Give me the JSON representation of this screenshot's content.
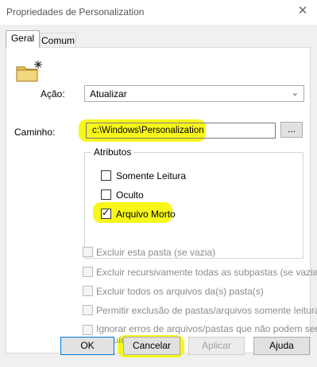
{
  "window": {
    "title": "Propriedades de Personalization",
    "close_glyph": "✕"
  },
  "tabs": [
    {
      "label": "Geral"
    },
    {
      "label": "Comum"
    }
  ],
  "action": {
    "label": "Ação:",
    "selected": "Atualizar",
    "arrow": "⌄"
  },
  "path": {
    "label": "Caminho:",
    "value": "c:\\Windows\\Personalization",
    "browse_label": "..."
  },
  "attributes": {
    "title": "Atributos",
    "items": [
      {
        "label": "Somente Leitura",
        "checked": false
      },
      {
        "label": "Oculto",
        "checked": false
      },
      {
        "label": "Arquivo Morto",
        "checked": true
      }
    ]
  },
  "options": [
    {
      "label": "Excluir esta pasta (se vazia)"
    },
    {
      "label": "Excluir recursivamente todas as subpastas (se vazias)"
    },
    {
      "label": "Excluir todos os arquivos da(s) pasta(s)"
    },
    {
      "label": "Permitir exclusão de pastas/arquivos somente leitura"
    },
    {
      "label_line1": "Ignorar erros de arquivos/pastas que não podem ser",
      "label_line2": "excluídos"
    }
  ],
  "buttons": {
    "ok": "OK",
    "cancel": "Cancelar",
    "apply": "Aplicar",
    "help": "Ajuda"
  },
  "highlight_color": "#f6f600"
}
